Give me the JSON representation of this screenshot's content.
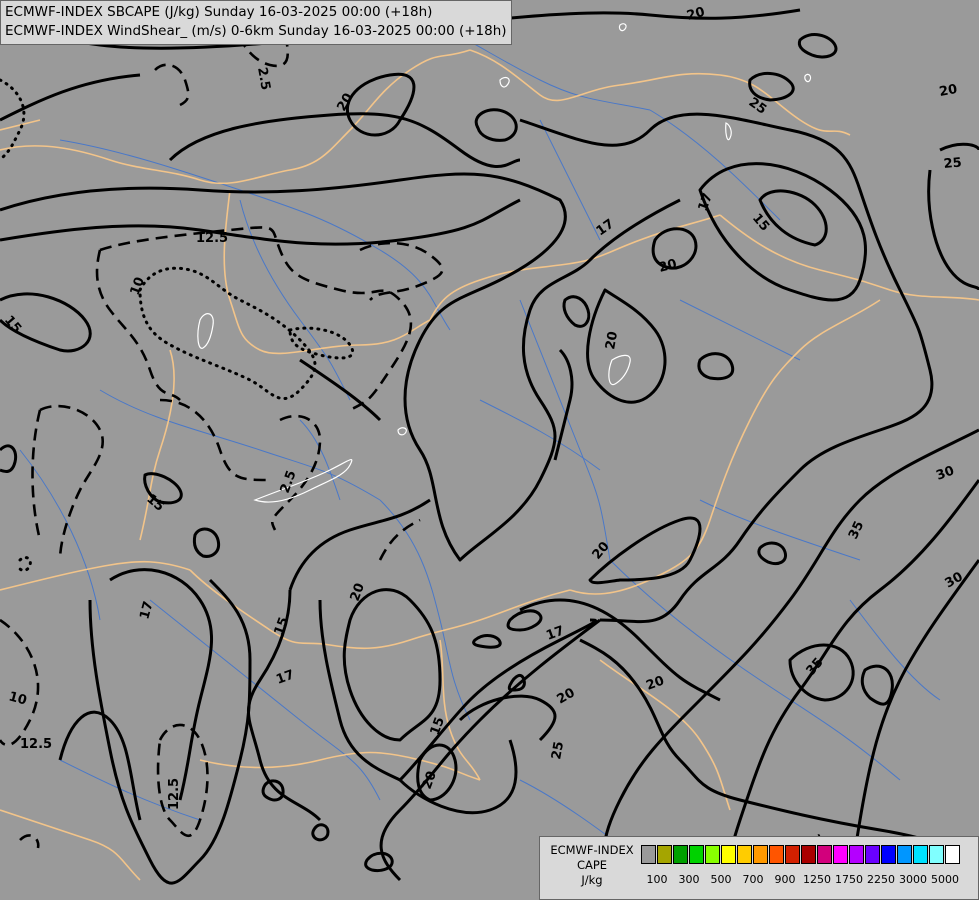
{
  "header": {
    "line1": "ECMWF-INDEX SBCAPE (J/kg) Sunday 16-03-2025 00:00 (+18h)",
    "line2": "ECMWF-INDEX WindShear_ (m/s) 0-6km Sunday 16-03-2025 00:00 (+18h)"
  },
  "legend": {
    "title_line1": "ECMWF-INDEX",
    "title_line2": "CAPE",
    "unit": "J/kg",
    "colors": [
      "#999999",
      "#a5a500",
      "#00a000",
      "#00d200",
      "#88ff00",
      "#ffff00",
      "#ffcc00",
      "#ff9900",
      "#ff5500",
      "#d22000",
      "#aa0000",
      "#d2007c",
      "#ff00ff",
      "#b400ff",
      "#6a00ff",
      "#0000ff",
      "#0096ff",
      "#00e1ff",
      "#80ffff",
      "#ffffff"
    ],
    "tick_labels": [
      "100",
      "300",
      "500",
      "700",
      "900",
      "1250",
      "1750",
      "2250",
      "3000",
      "5000"
    ]
  },
  "contour_labels": [
    "20",
    "25",
    "2.5",
    "20",
    "20",
    "17",
    "15",
    "17",
    "20",
    "25",
    "12.5",
    "10",
    "15",
    "20",
    "15",
    "2.5",
    "20",
    "20",
    "30",
    "35",
    "30",
    "35",
    "20",
    "17",
    "20",
    "25",
    "15",
    "17",
    "17",
    "12.5",
    "10",
    "12.5",
    "15",
    "20",
    "30"
  ],
  "colors": {
    "background": "#9a9a9a",
    "border": "#f2c48a",
    "river": "#4a78c8",
    "contour": "#000000"
  }
}
